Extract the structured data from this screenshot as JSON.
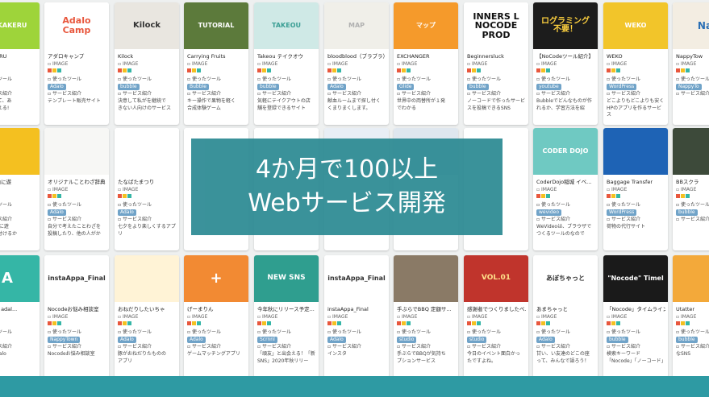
{
  "colors": {
    "overlay": "#2c8a93",
    "bottom_bar": "#2e9aa3",
    "tag": "#70a3c8"
  },
  "cards": [
    [
      {
        "title": "DEKAKERU",
        "type": "IMAGE",
        "line1": "使ったツール",
        "tool": "Adalo",
        "line3": "サービス紹介",
        "desc": "リを通して、あ\nとは出会える!\n勉強まで",
        "thumb": {
          "text": "DEKAKERU",
          "bg": "#9ed43a",
          "fg": "#ffffff",
          "size": 8
        }
      },
      {
        "title": "アダロキャンプ",
        "type": "IMAGE",
        "line1": "使ったツール",
        "tool": "Adalo",
        "line3": "サービス紹介",
        "desc": "テンプレート販売サイト",
        "thumb": {
          "text": "Adalo\nCamp",
          "bg": "#ffffff",
          "fg": "#e8573d",
          "size": 11
        }
      },
      {
        "title": "Kilock",
        "type": "IMAGE",
        "line1": "使ったツール",
        "tool": "bubble",
        "line3": "サービス紹介",
        "desc": "決意して私がを継続で\nきない人向けのサービス",
        "thumb": {
          "text": "Kilock",
          "bg": "#e9e6e0",
          "fg": "#333333",
          "size": 10
        }
      },
      {
        "title": "Carrying Fruits",
        "type": "IMAGE",
        "line1": "使ったツール",
        "tool": "Bubble",
        "line3": "サービス紹介",
        "desc": "キー操作で果物を軽く\n合成体験ゲーム",
        "thumb": {
          "text": "TUTORIAL",
          "bg": "#5c7a3b",
          "fg": "#ffffff",
          "size": 8
        }
      },
      {
        "title": "Takeou テイクオウ",
        "type": "IMAGE",
        "line1": "使ったツール",
        "tool": "bubble",
        "line3": "サービス紹介",
        "desc": "気軽にテイクアウトの店\n舗を登録できるサイト",
        "thumb": {
          "text": "TAKEOU",
          "bg": "#cfe9e6",
          "fg": "#3a9e94",
          "size": 8
        }
      },
      {
        "title": "bloodblood（ブラブラ）",
        "type": "IMAGE",
        "line1": "使ったツール",
        "tool": "Adalo",
        "line3": "サービス紹介",
        "desc": "献血ルームまで探し付く\nくまりまくします。",
        "thumb": {
          "text": "MAP",
          "bg": "#f0efe9",
          "fg": "#b0b0b0",
          "size": 8
        }
      },
      {
        "title": "EXCHANGER",
        "type": "IMAGE",
        "line1": "使ったツール",
        "tool": "Glide",
        "line3": "サービス紹介",
        "desc": "世界中の両替所が１発\nでわかる",
        "thumb": {
          "text": "マップ",
          "bg": "#f59a2b",
          "fg": "#ffffff",
          "size": 8
        }
      },
      {
        "title": "Beginnersluck",
        "type": "IMAGE",
        "line1": "使ったツール",
        "tool": "bubble",
        "line3": "サービス紹介",
        "desc": "ノーコードで作ったサービ\nスを投稿できるSNS",
        "thumb": {
          "text": "INNERS L\nNOCODE PROD",
          "bg": "#ffffff",
          "fg": "#111111",
          "size": 11
        }
      },
      {
        "title": "【NoCodeツール紹介】",
        "type": "IMAGE",
        "line1": "使ったツール",
        "tool": "youtube",
        "line3": "サービス紹介",
        "desc": "Bubbleでどんなものが作\nれるか、学習方法を紹",
        "thumb": {
          "text": "ログラミング\n不要！",
          "bg": "#1c1c1c",
          "fg": "#ffd23f",
          "size": 10
        }
      },
      {
        "title": "WEKO",
        "type": "IMAGE",
        "line1": "使ったツール",
        "tool": "WordPress",
        "line3": "サービス紹介",
        "desc": "どこよりもどこよりも安く\nHPのアプリを作るサービス",
        "thumb": {
          "text": "WEKO",
          "bg": "#f2c52a",
          "fg": "#ffffff",
          "size": 8
        }
      },
      {
        "title": "NappyTow",
        "type": "IMAGE",
        "line1": "使ったツール",
        "tool": "NappyTo",
        "line3": "サービス紹介",
        "desc": "",
        "thumb": {
          "text": "Na",
          "bg": "#f3ede2",
          "fg": "#2a6fb5",
          "size": 12
        }
      }
    ],
    [
      {
        "title": "童は 自由に遊",
        "type": "IMAGE",
        "line1": "使ったツール",
        "tool": "Adalo",
        "line3": "サービス紹介",
        "desc": "童は 自由に遊\nの人が気付けるか",
        "thumb": {
          "text": "",
          "bg": "#f4c020",
          "fg": "#333333",
          "size": 8
        }
      },
      {
        "title": "オリジナルことわざ辞典",
        "type": "IMAGE",
        "line1": "使ったツール",
        "tool": "Adalo",
        "line3": "サービス紹介",
        "desc": "自分で考えたことわざを\n投稿したり、他の人がか",
        "thumb": {
          "text": "",
          "bg": "#f7f7f5",
          "fg": "#333333",
          "size": 8
        }
      },
      {
        "title": "たなばたまつり",
        "type": "IMAGE",
        "line1": "使ったツール",
        "tool": "Adalo",
        "line3": "サービス紹介",
        "desc": "七夕をより楽しくするアプ\nリ",
        "thumb": {
          "text": "",
          "bg": "#ffffff",
          "fg": "#333333",
          "size": 8
        }
      },
      {
        "title": "",
        "type": "",
        "line1": "",
        "tool": "",
        "line3": "",
        "desc": "",
        "thumb": {
          "text": "",
          "bg": "#ffffff",
          "fg": "#333333",
          "size": 8
        }
      },
      {
        "title": "",
        "type": "",
        "line1": "",
        "tool": "",
        "line3": "",
        "desc": "",
        "thumb": {
          "text": "",
          "bg": "#ffffff",
          "fg": "#333333",
          "size": 8
        }
      },
      {
        "title": "",
        "type": "",
        "line1": "",
        "tool": "",
        "line3": "",
        "desc": "",
        "thumb": {
          "text": "",
          "bg": "#e8eef5",
          "fg": "#333333",
          "size": 8
        }
      },
      {
        "title": "",
        "type": "",
        "line1": "",
        "tool": "",
        "line3": "",
        "desc": "",
        "thumb": {
          "text": "",
          "bg": "#dfe7ef",
          "fg": "#333333",
          "size": 8
        }
      },
      {
        "title": "",
        "type": "",
        "line1": "",
        "tool": "",
        "line3": "",
        "desc": "",
        "thumb": {
          "text": "",
          "bg": "#ffffff",
          "fg": "#333333",
          "size": 8
        }
      },
      {
        "title": "CoderDojo稲城 イベ...",
        "type": "IMAGE",
        "line1": "使ったツール",
        "tool": "wevideo",
        "line3": "サービス紹介",
        "desc": "WeVideoは、ブラウザで\nつくるツールのなので",
        "thumb": {
          "text": "CODER DOJO",
          "bg": "#6fc9c2",
          "fg": "#ffffff",
          "size": 8
        }
      },
      {
        "title": "Baggage Transfer",
        "type": "IMAGE",
        "line1": "使ったツール",
        "tool": "WordPress",
        "line3": "サービス紹介",
        "desc": "荷物の代行サイト",
        "thumb": {
          "text": "",
          "bg": "#1e63b5",
          "fg": "#ffffff",
          "size": 8
        }
      },
      {
        "title": "BBスクラ",
        "type": "IMAGE",
        "line1": "使ったツール",
        "tool": "bubble",
        "line3": "サービス紹介",
        "desc": "",
        "thumb": {
          "text": "",
          "bg": "#3d4a3a",
          "fg": "#ffffff",
          "size": 8
        }
      }
    ],
    [
      {
        "title": "回ろう！ adal...",
        "type": "IMAGE",
        "line1": "使ったツール",
        "tool": "Adalo",
        "line3": "サービス紹介",
        "desc": "使い方Adalo",
        "thumb": {
          "text": "A",
          "bg": "#35b6a6",
          "fg": "#ffffff",
          "size": 18
        }
      },
      {
        "title": "Nocodeお悩み相談室",
        "type": "IMAGE",
        "line1": "使ったツール",
        "tool": "NappyTown",
        "line3": "サービス紹介",
        "desc": "Nocodeお悩み相談室",
        "thumb": {
          "text": "instaAppa_Final",
          "bg": "#ffffff",
          "fg": "#333333",
          "size": 8
        }
      },
      {
        "title": "おねだりしたいちゃ",
        "type": "IMAGE",
        "line1": "使ったツール",
        "tool": "Adalo",
        "line3": "サービス紹介",
        "desc": "豚がおねだりたものの\nアプリ",
        "thumb": {
          "text": "",
          "bg": "#fff3d6",
          "fg": "#333333",
          "size": 8
        }
      },
      {
        "title": "げーまりん",
        "type": "IMAGE",
        "line1": "使ったツール",
        "tool": "Adalo",
        "line3": "サービス紹介",
        "desc": "ゲームマッチングアプリ",
        "thumb": {
          "text": "+",
          "bg": "#f28a33",
          "fg": "#ffffff",
          "size": 18
        }
      },
      {
        "title": "今年秋にリリース予定...",
        "type": "IMAGE",
        "line1": "使ったツール",
        "tool": "Scrnnl",
        "line3": "サービス紹介",
        "desc": "「頑友」と出会える！「新\nSNS」2020年秋リリー",
        "thumb": {
          "text": "NEW SNS",
          "bg": "#2f9e8f",
          "fg": "#ffffff",
          "size": 9
        }
      },
      {
        "title": "instaAppa_Final",
        "type": "IMAGE",
        "line1": "使ったツール",
        "tool": "Adalo",
        "line3": "サービス紹介",
        "desc": "インスタ",
        "thumb": {
          "text": "instaAppa_Final",
          "bg": "#ffffff",
          "fg": "#333333",
          "size": 8
        }
      },
      {
        "title": "手ぶらでBBQ 定額サ...",
        "type": "IMAGE",
        "line1": "使ったツール",
        "tool": "studio",
        "line3": "サービス紹介",
        "desc": "手ぶらでBBQが気持ち\nプションサービス",
        "thumb": {
          "text": "",
          "bg": "#8a7a66",
          "fg": "#ffffff",
          "size": 8
        }
      },
      {
        "title": "感謝者でつくりましたべ...",
        "type": "IMAGE",
        "line1": "使ったツール",
        "tool": "studio",
        "line3": "サービス紹介",
        "desc": "今日のイベント面白かっ\nたですよね。",
        "thumb": {
          "text": "VOL.01",
          "bg": "#c0342c",
          "fg": "#ffe08a",
          "size": 9
        }
      },
      {
        "title": "あまちゃっと",
        "type": "IMAGE",
        "line1": "使ったツール",
        "tool": "Adalo",
        "line3": "サービス紹介",
        "desc": "甘い、い友達のどこの座\nって、みんなで語ろう！",
        "thumb": {
          "text": "あぼちゃっと",
          "bg": "#ffffff",
          "fg": "#333333",
          "size": 8
        }
      },
      {
        "title": "「Nocode」タイムライン",
        "type": "IMAGE",
        "line1": "使ったツール",
        "tool": "bubble",
        "line3": "サービス紹介",
        "desc": "検索キーワード\n「Nocode」「ノーコード」",
        "thumb": {
          "text": "\"Nocode\" Timel",
          "bg": "#1a1a1a",
          "fg": "#ffffff",
          "size": 8
        }
      },
      {
        "title": "Utatter",
        "type": "IMAGE",
        "line1": "使ったツール",
        "tool": "bubble",
        "line3": "サービス紹介",
        "desc": "なSNS",
        "thumb": {
          "text": "",
          "bg": "#f3a93a",
          "fg": "#ffffff",
          "size": 8
        }
      }
    ]
  ],
  "overlay": {
    "line1": "4か月で100以上",
    "line2": "Webサービス開発"
  }
}
